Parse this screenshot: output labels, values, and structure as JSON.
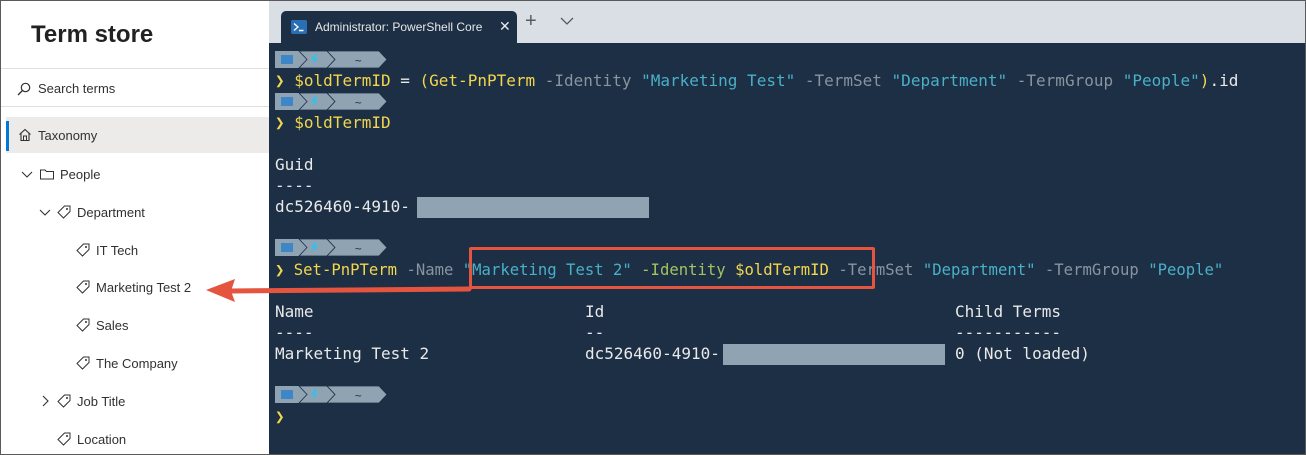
{
  "term_store": {
    "title": "Term store",
    "search_placeholder": "Search terms",
    "tree": [
      {
        "label": "Taxonomy"
      },
      {
        "label": "People"
      },
      {
        "label": "Department"
      },
      {
        "label": "IT Tech"
      },
      {
        "label": "Marketing Test 2"
      },
      {
        "label": "Sales"
      },
      {
        "label": "The Company"
      },
      {
        "label": "Job Title"
      },
      {
        "label": "Location"
      }
    ]
  },
  "terminal": {
    "tab_title": "Administrator: PowerShell Core",
    "tab_close": "✕",
    "tab_new": "+",
    "prompt_symbol": "❯",
    "prompt_tilde": "~",
    "cmd1": {
      "var": "$oldTermID",
      "eq": " = ",
      "open": "(",
      "cmdlet": "Get-PnPTerm",
      "p1": " -Identity ",
      "v1": "\"Marketing Test\"",
      "p2": " -TermSet ",
      "v2": "\"Department\"",
      "p3": " -TermGroup ",
      "v3": "\"People\"",
      "close": ")",
      "tail": ".id"
    },
    "cmd2": {
      "var": "$oldTermID"
    },
    "out1": {
      "header": "Guid",
      "sep": "----",
      "value": "dc526460-4910-"
    },
    "cmd3": {
      "cmdlet": "Set-PnPTerm",
      "p1": " -Name ",
      "v1": "\"Marketing Test 2\"",
      "p2": " -Identity ",
      "v2": "$oldTermID",
      "p3": " -TermSet ",
      "v3": "\"Department\"",
      "p4": " -TermGroup ",
      "v4": "\"People\""
    },
    "out2": {
      "col1": "Name",
      "col2": "Id",
      "col3": "Child Terms",
      "sep1": "----",
      "sep2": "--",
      "sep3": "-----------",
      "name": "Marketing Test 2",
      "id": "dc526460-4910-",
      "child": "0 (Not loaded)"
    }
  },
  "colors": {
    "terminal_bg": "#1c2f44",
    "accent": "#0078d4",
    "callout": "#e4543f",
    "string": "#4ab0c8",
    "cmdlet": "#f3d64e",
    "param": "#a5c261"
  }
}
